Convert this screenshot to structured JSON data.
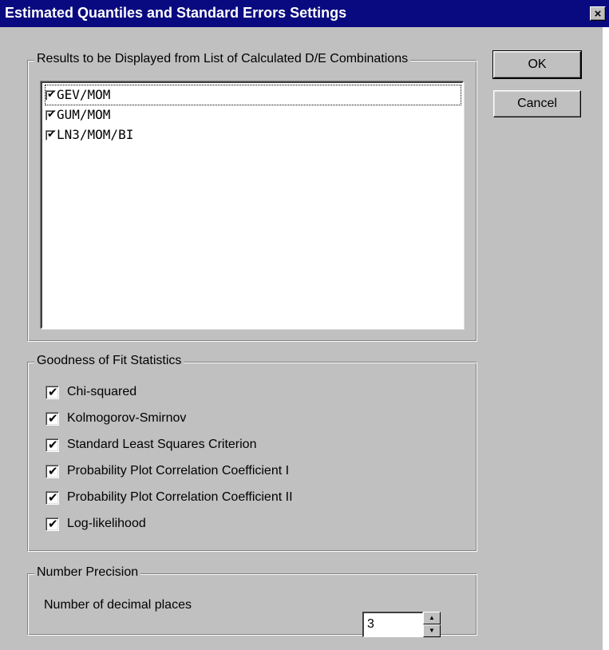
{
  "window": {
    "title": "Estimated Quantiles and Standard Errors Settings",
    "close_glyph": "×"
  },
  "results_group": {
    "label": "Results to be Displayed from List of Calculated D/E Combinations",
    "items": [
      {
        "label": "GEV/MOM",
        "checked": true,
        "focused": true
      },
      {
        "label": "GUM/MOM",
        "checked": true
      },
      {
        "label": "LN3/MOM/BI",
        "checked": true
      }
    ]
  },
  "buttons": {
    "ok": "OK",
    "cancel": "Cancel"
  },
  "gof_group": {
    "label": "Goodness of Fit Statistics",
    "items": [
      {
        "label": "Chi-squared",
        "checked": true
      },
      {
        "label": "Kolmogorov-Smirnov",
        "checked": true
      },
      {
        "label": "Standard Least Squares Criterion",
        "checked": true
      },
      {
        "label": "Probability Plot Correlation Coefficient I",
        "checked": true
      },
      {
        "label": "Probability Plot Correlation Coefficient II",
        "checked": true
      },
      {
        "label": "Log-likelihood",
        "checked": true
      }
    ]
  },
  "precision_group": {
    "label": "Number Precision",
    "decimal_label": "Number of decimal places",
    "decimal_value": "3"
  },
  "check_glyph": "✔",
  "colors": {
    "titlebar": "#0a0a80",
    "face": "#c0c0c0"
  }
}
